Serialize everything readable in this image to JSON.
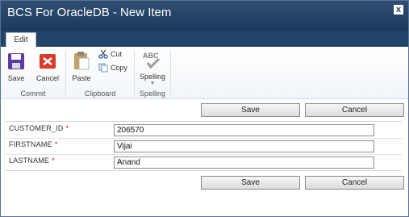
{
  "window": {
    "title": "BCS For OracleDB - New Item",
    "close_glyph": "x"
  },
  "ribbon": {
    "tab": "Edit",
    "groups": [
      {
        "label": "Commit",
        "buttons": [
          "Save",
          "Cancel"
        ]
      },
      {
        "label": "Clipboard",
        "paste": "Paste",
        "cut": "Cut",
        "copy": "Copy"
      },
      {
        "label": "Spelling",
        "spelling": "Spelling",
        "spelling_icon_text": "ABC"
      }
    ]
  },
  "form": {
    "save_label": "Save",
    "cancel_label": "Cancel",
    "required_mark": "*",
    "fields": [
      {
        "label": "CUSTOMER_ID",
        "value": "206570"
      },
      {
        "label": "FIRSTNAME",
        "value": "Vijai"
      },
      {
        "label": "LASTNAME",
        "value": "Anand"
      }
    ]
  },
  "colors": {
    "title_bar": "#1e3a5c",
    "required": "#dd1111"
  }
}
